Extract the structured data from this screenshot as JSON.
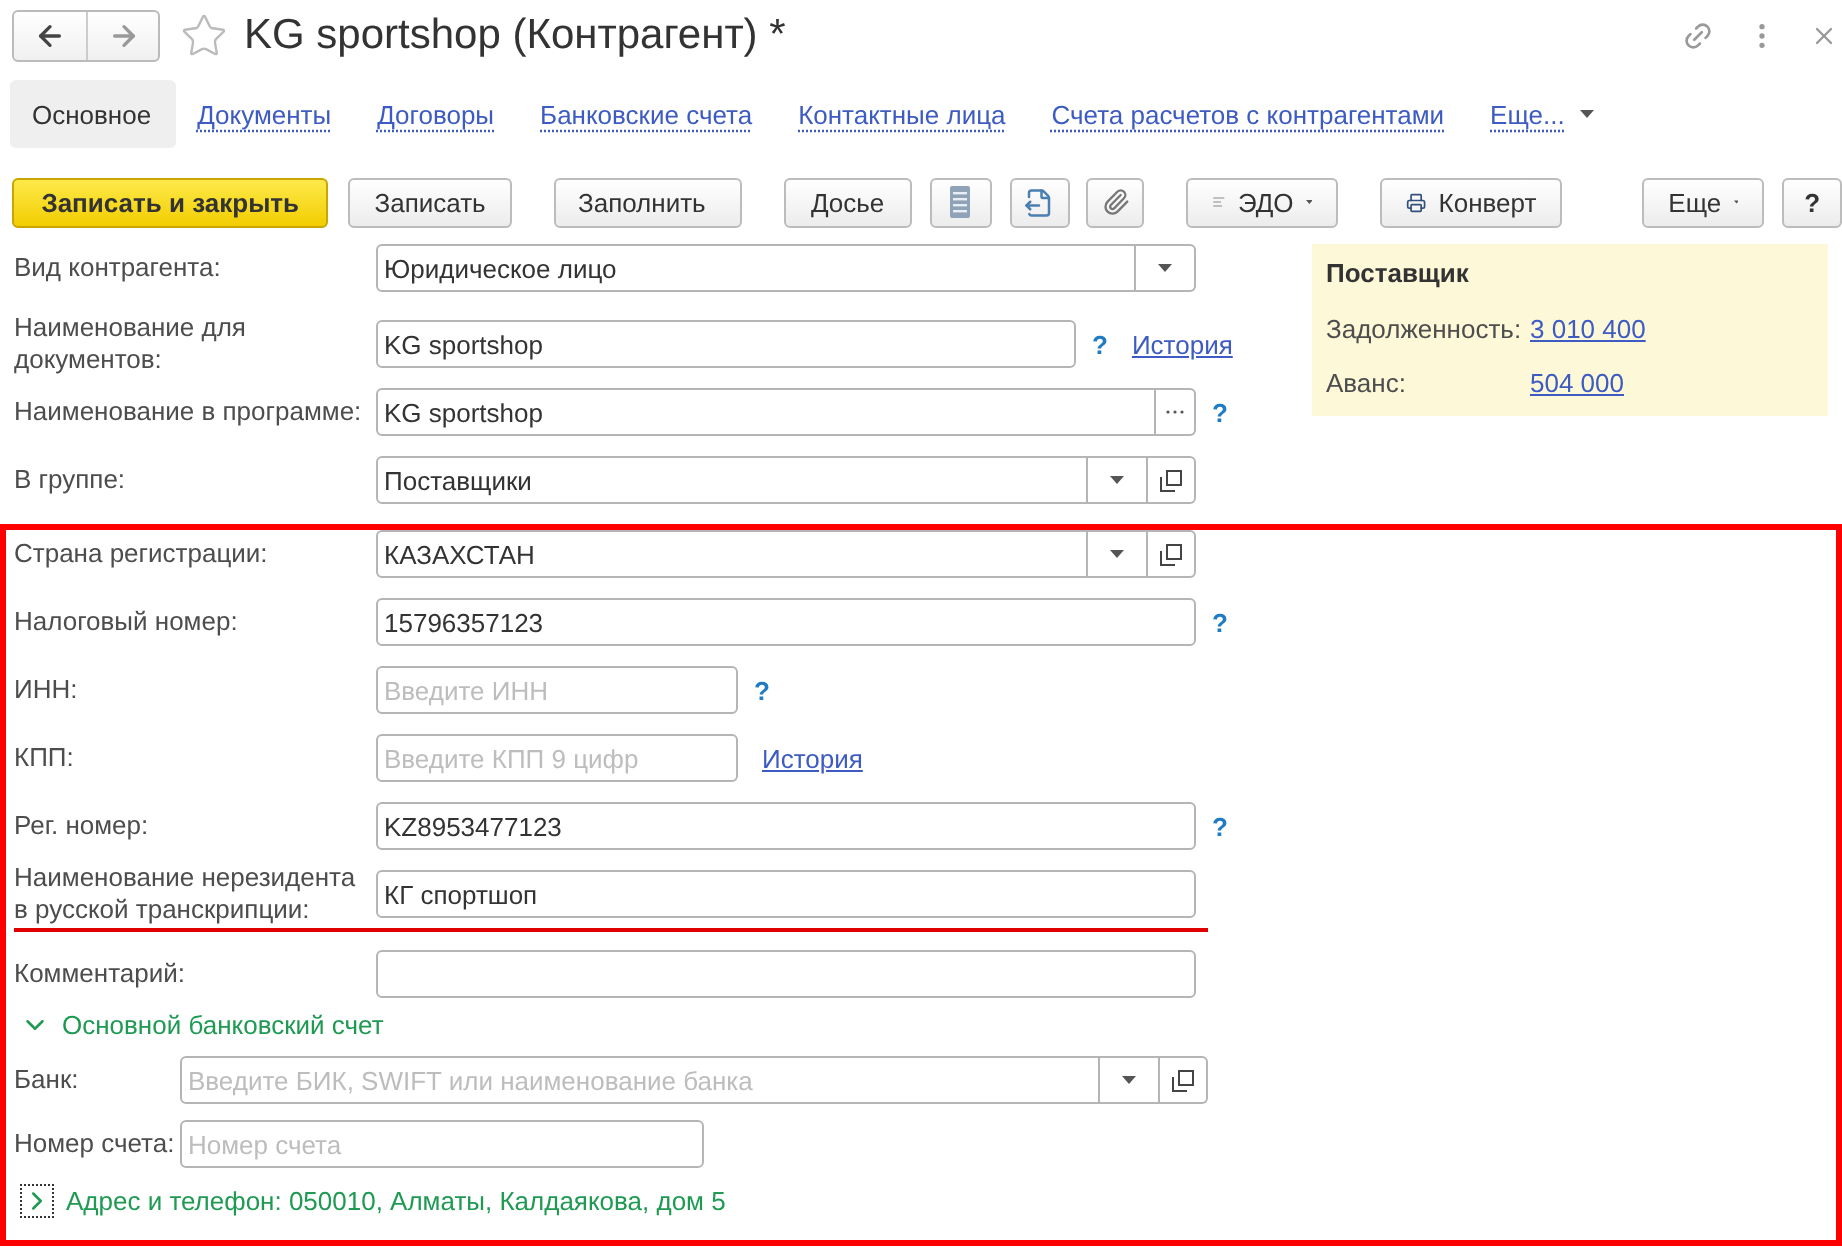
{
  "window": {
    "title": "KG sportshop (Контрагент) *"
  },
  "tabs": [
    {
      "label": "Основное",
      "selected": true
    },
    {
      "label": "Документы",
      "selected": false
    },
    {
      "label": "Договоры",
      "selected": false
    },
    {
      "label": "Банковские счета",
      "selected": false
    },
    {
      "label": "Контактные лица",
      "selected": false
    },
    {
      "label": "Счета расчетов с контрагентами",
      "selected": false
    }
  ],
  "tabs_more": "Еще...",
  "toolbar": {
    "save_close": "Записать и закрыть",
    "save": "Записать",
    "fill": "Заполнить",
    "dossier": "Досье",
    "edo": "ЭДО",
    "envelope": "Конверт",
    "more": "Еще",
    "help": "?"
  },
  "fields": [
    {
      "kind": "select-plain",
      "label": "Вид контрагента:",
      "value": "Юридическое лицо"
    },
    {
      "kind": "text-medium",
      "label": "Наименование для документов:",
      "value": "KG sportshop",
      "help": "?",
      "link": "История"
    },
    {
      "kind": "choice",
      "label": "Наименование в программе:",
      "value": "KG sportshop",
      "help": "?"
    },
    {
      "kind": "select",
      "label": "В группе:",
      "value": "Поставщики"
    }
  ],
  "supplier": {
    "title": "Поставщик",
    "rows": [
      {
        "label": "Задолженность:",
        "value": "3 010 400"
      },
      {
        "label": "Аванс:",
        "value": "504 000"
      }
    ]
  },
  "highlighted_fields": [
    {
      "kind": "select",
      "label": "Страна регистрации:",
      "value": "КАЗАХСТАН"
    },
    {
      "kind": "text",
      "label": "Налоговый номер:",
      "value": "15796357123",
      "help": "?"
    },
    {
      "kind": "short",
      "label": "ИНН:",
      "placeholder": "Введите ИНН",
      "help": "?"
    },
    {
      "kind": "short",
      "label": "КПП:",
      "placeholder": "Введите КПП 9 цифр",
      "link": "История"
    },
    {
      "kind": "text",
      "label": "Рег. номер:",
      "value": "KZ8953477123",
      "help": "?"
    },
    {
      "kind": "text",
      "label": "Наименование нерезидента в русской транскрипции:",
      "value": "КГ спортшоп",
      "underlined": true
    }
  ],
  "more_fields": [
    {
      "kind": "text",
      "label": "Комментарий:"
    }
  ],
  "bank_section": {
    "title": "Основной банковский счет",
    "expanded": true,
    "fields": [
      {
        "kind": "select",
        "label": "Банк:",
        "placeholder": "Введите БИК, SWIFT или наименование банка"
      },
      {
        "kind": "short",
        "label": "Номер счета:",
        "placeholder": "Номер счета"
      }
    ]
  },
  "address_section": {
    "title": "Адрес и телефон: 050010, Алматы, Калдаякова, дом 5",
    "expanded": false
  }
}
